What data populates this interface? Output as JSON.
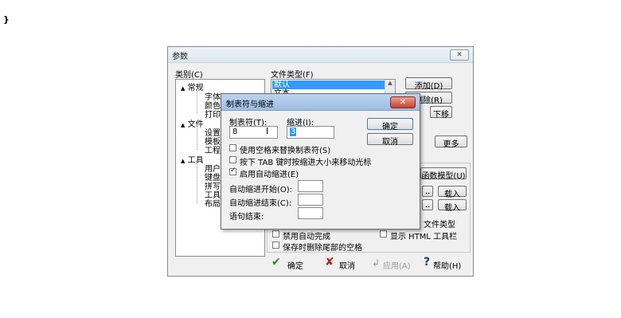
{
  "stray_text": "}",
  "window": {
    "title": "参数",
    "close_glyph": "✕",
    "category_label": "类别(C)",
    "filetype_label": "文件类型(F)",
    "tree": [
      {
        "toggle": "▲",
        "label": "常规"
      },
      {
        "label": "字体"
      },
      {
        "label": "颜色"
      },
      {
        "label": "打印"
      },
      {
        "toggle": "▲",
        "label": "文件"
      },
      {
        "label": "设置"
      },
      {
        "label": "模板"
      },
      {
        "label": "工程"
      },
      {
        "toggle": "▲",
        "label": "工具"
      },
      {
        "label": "用户"
      },
      {
        "label": "键盘"
      },
      {
        "label": "拼写"
      },
      {
        "label": "工具"
      },
      {
        "label": "布局"
      }
    ],
    "filetype_list": [
      "默认",
      "文本"
    ],
    "buttons": {
      "add": "添加(D)",
      "delete": "删除(R)",
      "move_down": "下移",
      "more": "更多",
      "function_model": "函数模型(U)",
      "load1": "载入",
      "load2": "载入",
      "dots": ".."
    },
    "behind_text": "文件类型",
    "options": {
      "disable_autocomplete": "禁用自动完成",
      "show_html_toolbar": "显示 HTML 工具栏",
      "keep_trailing_spaces": "保存时删除尾部的空格"
    },
    "footer": {
      "ok": "确定",
      "cancel": "取消",
      "apply": "应用(A)",
      "help": "帮助(H)"
    }
  },
  "dialog": {
    "title": "制表符与缩进",
    "close_glyph": "✕",
    "tab_label": "制表符(T):",
    "tab_value": "8",
    "indent_label": "缩进(I):",
    "indent_value": "3",
    "ok": "确定",
    "cancel": "取消",
    "checks": [
      {
        "label": "使用空格来替换制表符(S)",
        "checked": false
      },
      {
        "label": "按下 TAB 键时按缩进大小来移动光标",
        "checked": false
      },
      {
        "label": "启用自动缩进(E)",
        "checked": true
      }
    ],
    "auto_indent_start": "自动缩进开始(O):",
    "auto_indent_end": "自动缩进结束(C):",
    "statement_end": "语句结束:"
  },
  "colors": {
    "selection": "#3399ff",
    "ok_check": "#2f8a1f",
    "cancel_x": "#b3261e"
  }
}
